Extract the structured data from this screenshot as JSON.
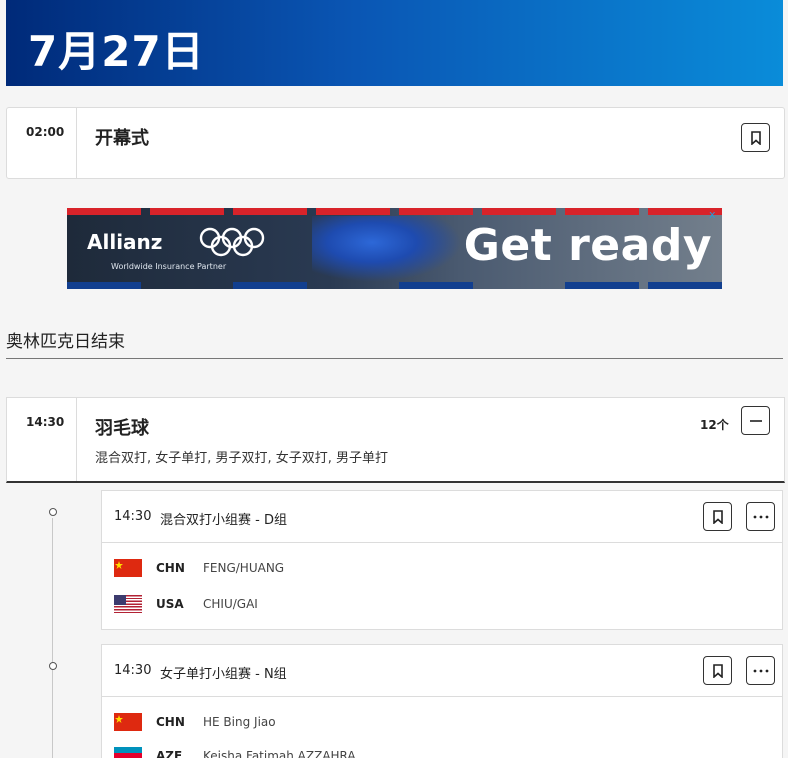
{
  "date_header": "7月27日",
  "opening": {
    "time": "02:00",
    "title": "开幕式"
  },
  "ad": {
    "brand": "Allianz",
    "subtitle": "Worldwide Insurance Partner",
    "cta": "Get ready",
    "close_label": "x"
  },
  "section": {
    "title": "奥林匹克日结束"
  },
  "badminton": {
    "time": "14:30",
    "title": "羽毛球",
    "count": "12个",
    "disciplines": "混合双打, 女子单打, 男子双打, 女子双打, 男子单打"
  },
  "events": [
    {
      "time": "14:30",
      "title": "混合双打小组赛 - D组",
      "rows": [
        {
          "code": "CHN",
          "name": "FENG/HUANG"
        },
        {
          "code": "USA",
          "name": "CHIU/GAI"
        }
      ]
    },
    {
      "time": "14:30",
      "title": "女子单打小组赛 - N组",
      "rows": [
        {
          "code": "CHN",
          "name": "HE Bing Jiao"
        },
        {
          "code": "AZE",
          "name": "Keisha Fatimah AZZAHRA"
        }
      ]
    }
  ],
  "colors": {
    "header_start": "#002a79",
    "header_end": "#0a8cd9",
    "chn_red": "#de2910",
    "chn_yellow": "#ffde00"
  }
}
